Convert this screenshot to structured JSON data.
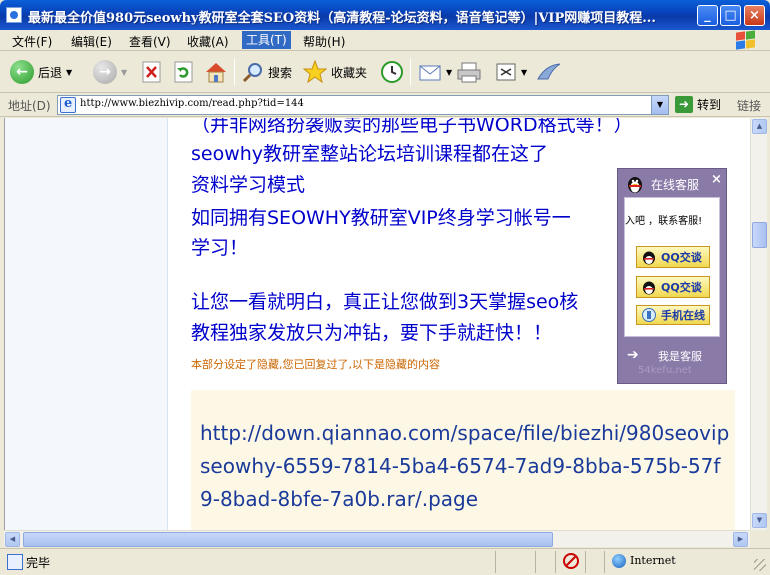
{
  "window": {
    "title": "最新最全价值980元seowhy教研室全套SEO资料（高清教程-论坛资料，语音笔记等）|VIP网赚项目教程...",
    "min_label": "_",
    "max_label": "□",
    "close_label": "×"
  },
  "menu": {
    "items": [
      "文件(F)",
      "编辑(E)",
      "查看(V)",
      "收藏(A)",
      "工具(T)",
      "帮助(H)"
    ]
  },
  "toolbar": {
    "back_label": "后退",
    "search_label": "搜索",
    "favorites_label": "收藏夹"
  },
  "address": {
    "label": "地址(D)",
    "url": "http://www.biezhivip.com/read.php?tid=144",
    "go_label": "转到",
    "links_label": "链接"
  },
  "content": {
    "lines": [
      "（并非网络扮袭贩卖的那些电子书WORD格式等！）",
      "seowhy教研室整站论坛培训课程都在这了",
      "资料学习模式",
      "如同拥有SEOWHY教研室VIP终身学习帐号一",
      "学习！",
      "让您一看就明白，真正让您做到3天掌握seo核",
      "教程独家发放只为冲钻，要下手就赶快！！"
    ],
    "hidden_note": "本部分设定了隐藏,您已回复过了,以下是隐藏的内容",
    "download_link": "http://down.qiannao.com/space/file/biezhi/980seovipseowhy-6559-7814-5ba4-6574-7ad9-8bba-575b-57f9-8bad-8bfe-7a0b.rar/.page"
  },
  "chat": {
    "title": "在线客服",
    "close_label": "×",
    "scroll_text": "入吧 ，联系客服!",
    "qq1_label": "QQ交谈",
    "qq2_label": "QQ交谈",
    "mobile_label": "手机在线",
    "foot_label": "我是客服",
    "watermark": "54kefu.net"
  },
  "status": {
    "text": "完毕",
    "zone": "Internet"
  },
  "colors": {
    "title_bar": "#0a46c0",
    "content_text": "#0000cc",
    "hidden_note": "#cc6600",
    "link_box_bg": "#fdf8e6",
    "chat_bg": "#8a7aa8"
  }
}
